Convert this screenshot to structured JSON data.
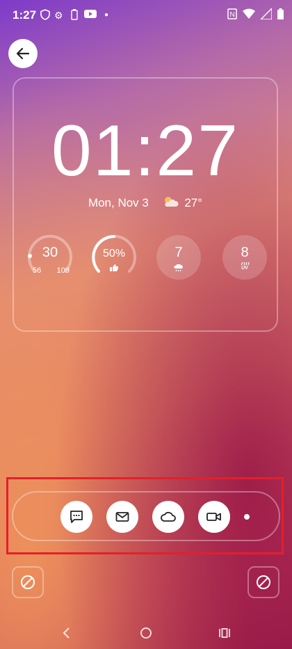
{
  "status_bar": {
    "time": "1:27",
    "left_icons": [
      "shield-icon",
      "gear-icon",
      "battery-saver-icon",
      "youtube-icon",
      "dot-icon"
    ],
    "right_icons": [
      "nfc-icon",
      "wifi-icon",
      "signal-icon",
      "battery-icon"
    ]
  },
  "back_button": {
    "icon": "arrow-left-icon"
  },
  "widget": {
    "time": "01:27",
    "date": "Mon, Nov 3",
    "weather_icon": "partly-cloudy-icon",
    "temperature": "27°",
    "stats": [
      {
        "value": "30",
        "low": "56",
        "high": "109"
      },
      {
        "value": "50%",
        "icon": "thumb-icon",
        "progress": 0.5
      },
      {
        "value": "7",
        "icon": "rain-icon"
      },
      {
        "value": "8",
        "sub": "UV"
      }
    ]
  },
  "actions": [
    {
      "name": "message",
      "icon": "message-icon"
    },
    {
      "name": "email",
      "icon": "mail-icon"
    },
    {
      "name": "cloud",
      "icon": "cloud-icon"
    },
    {
      "name": "video",
      "icon": "video-camera-icon"
    }
  ],
  "nav_bar": {
    "icons": [
      "back-triangle-icon",
      "home-circle-icon",
      "recents-icon"
    ]
  }
}
